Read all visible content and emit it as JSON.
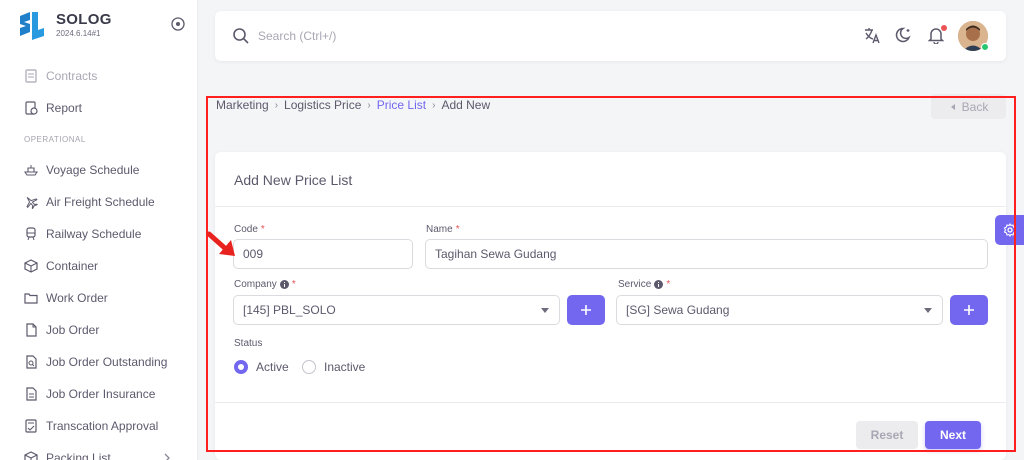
{
  "app": {
    "name": "SOLOG",
    "version": "2024.6.14#1"
  },
  "sidebar": {
    "items": [
      {
        "label": "Contracts",
        "icon": "contracts-icon",
        "faded": true
      },
      {
        "label": "Report",
        "icon": "report-icon"
      }
    ],
    "section_header": "OPERATIONAL",
    "operational_items": [
      {
        "label": "Voyage Schedule",
        "icon": "ship-icon"
      },
      {
        "label": "Air Freight Schedule",
        "icon": "plane-icon"
      },
      {
        "label": "Railway Schedule",
        "icon": "train-icon"
      },
      {
        "label": "Container",
        "icon": "box-icon"
      },
      {
        "label": "Work Order",
        "icon": "folder-icon"
      },
      {
        "label": "Job Order",
        "icon": "file-icon"
      },
      {
        "label": "Job Order Outstanding",
        "icon": "file-search-icon"
      },
      {
        "label": "Job Order Insurance",
        "icon": "file-text-icon"
      },
      {
        "label": "Transcation Approval",
        "icon": "file-check-icon"
      },
      {
        "label": "Packing List",
        "icon": "package-icon",
        "has_submenu": true
      }
    ]
  },
  "navbar": {
    "search_placeholder": "Search (Ctrl+/)",
    "icons": [
      "translate-icon",
      "moon-icon",
      "bell-icon"
    ],
    "notification_dot": true
  },
  "breadcrumb": {
    "items": [
      "Marketing",
      "Logistics Price",
      "Price List",
      "Add New"
    ],
    "active_link_index": 2
  },
  "back_button": {
    "label": "Back"
  },
  "form": {
    "title": "Add New Price List",
    "code": {
      "label": "Code",
      "value": "009"
    },
    "name": {
      "label": "Name",
      "value": "Tagihan Sewa Gudang"
    },
    "company": {
      "label": "Company",
      "value": "[145] PBL_SOLO"
    },
    "service": {
      "label": "Service",
      "value": "[SG] Sewa Gudang"
    },
    "status": {
      "label": "Status",
      "options": [
        "Active",
        "Inactive"
      ],
      "selected": "Active"
    },
    "reset_label": "Reset",
    "next_label": "Next"
  },
  "colors": {
    "primary": "#7367f0",
    "required": "#ea5455",
    "annotation": "#ff1f1f",
    "online": "#28c76f"
  }
}
